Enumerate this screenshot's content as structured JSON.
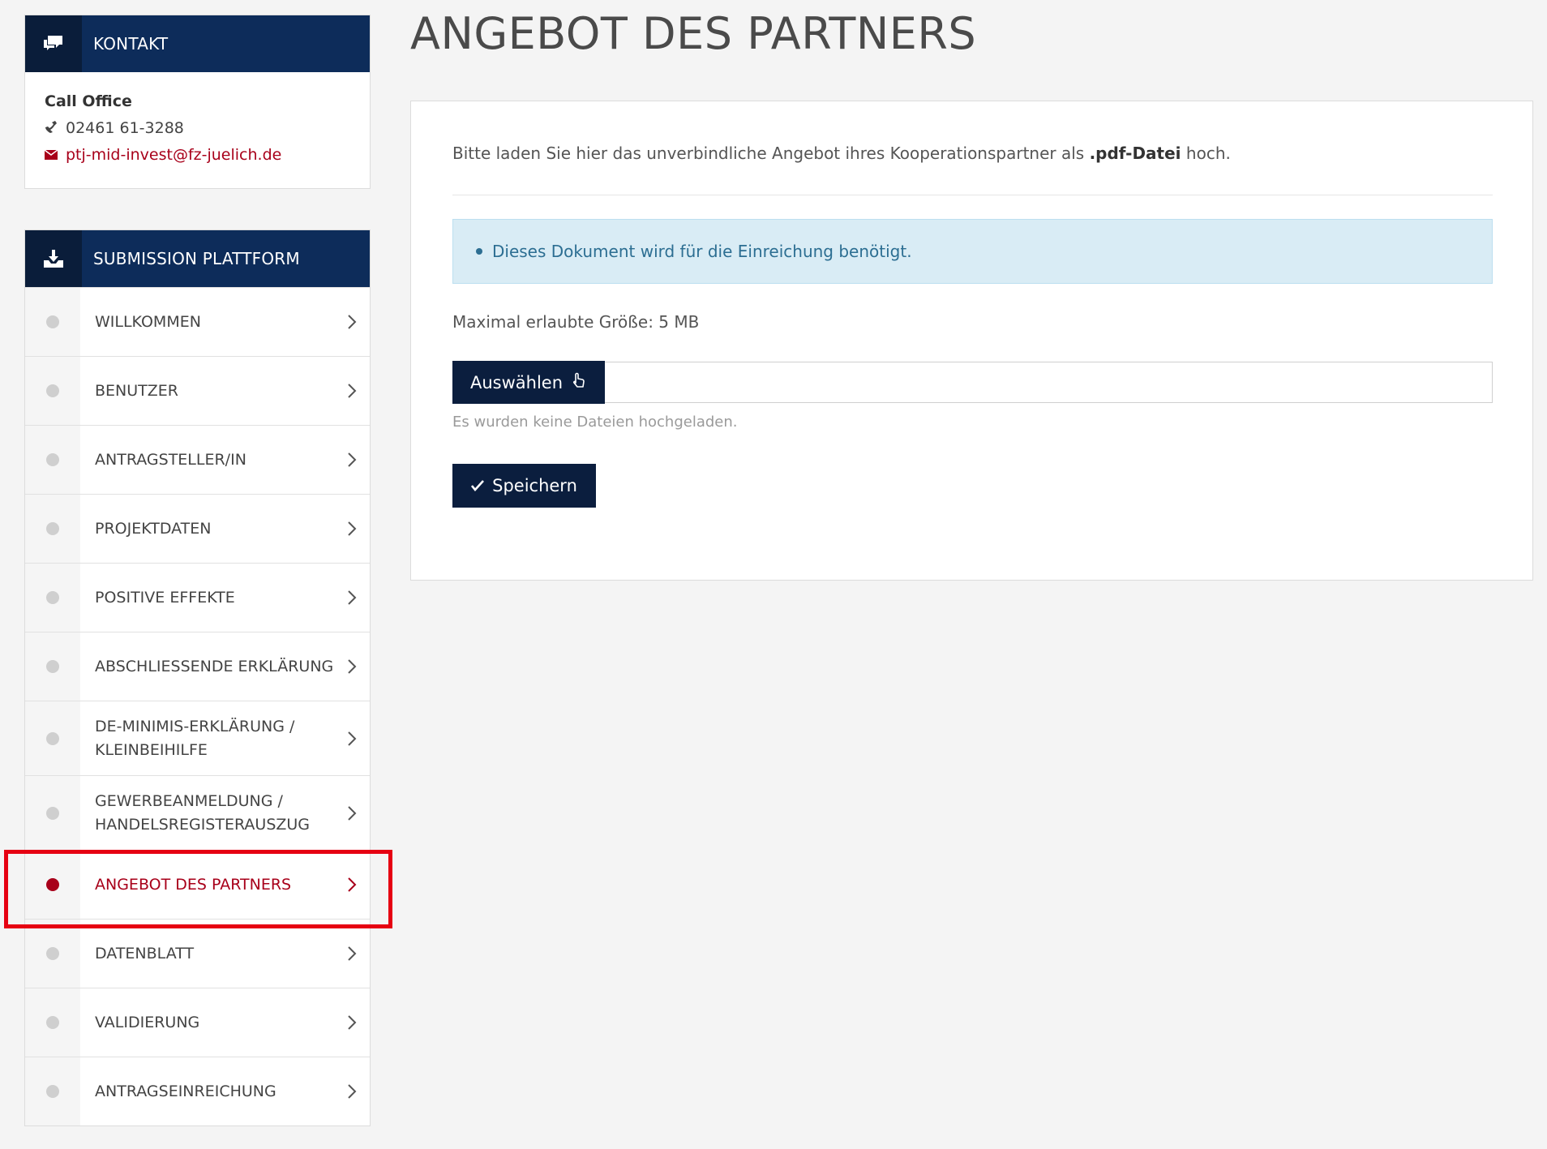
{
  "contact": {
    "header": "KONTAKT",
    "title": "Call Office",
    "phone": "02461 61-3288",
    "email": "ptj-mid-invest@fz-juelich.de"
  },
  "submission": {
    "header": "SUBMISSION PLATTFORM",
    "items": [
      {
        "label": "WILLKOMMEN"
      },
      {
        "label": "BENUTZER"
      },
      {
        "label": "ANTRAGSTELLER/IN"
      },
      {
        "label": "PROJEKTDATEN"
      },
      {
        "label": "POSITIVE EFFEKTE"
      },
      {
        "label": "ABSCHLIESSENDE ERKLÄRUNG"
      },
      {
        "label_line1": "DE-MINIMIS-ERKLÄRUNG /",
        "label_line2": "KLEINBEIHILFE"
      },
      {
        "label_line1": "GEWERBEANMELDUNG /",
        "label_line2": "HANDELSREGISTERAUSZUG"
      },
      {
        "label": "ANGEBOT DES PARTNERS",
        "active": true
      },
      {
        "label": "DATENBLATT"
      },
      {
        "label": "VALIDIERUNG"
      },
      {
        "label": "ANTRAGSEINREICHUNG"
      }
    ]
  },
  "main": {
    "title": "ANGEBOT DES PARTNERS",
    "intro_prefix": "Bitte laden Sie hier das unverbindliche Angebot ihres Kooperationspartner als ",
    "intro_bold": ".pdf-Datei",
    "intro_suffix": " hoch.",
    "alert": "Dieses Dokument wird für die Einreichung benötigt.",
    "max_size": "Maximal erlaubte Größe: 5 MB",
    "choose_label": "Auswählen",
    "no_files": "Es wurden keine Dateien hochgeladen.",
    "save_label": "Speichern"
  },
  "colors": {
    "navy": "#0d2c5a",
    "accent_red": "#a8001a",
    "alert_bg": "#d9ecf5"
  }
}
